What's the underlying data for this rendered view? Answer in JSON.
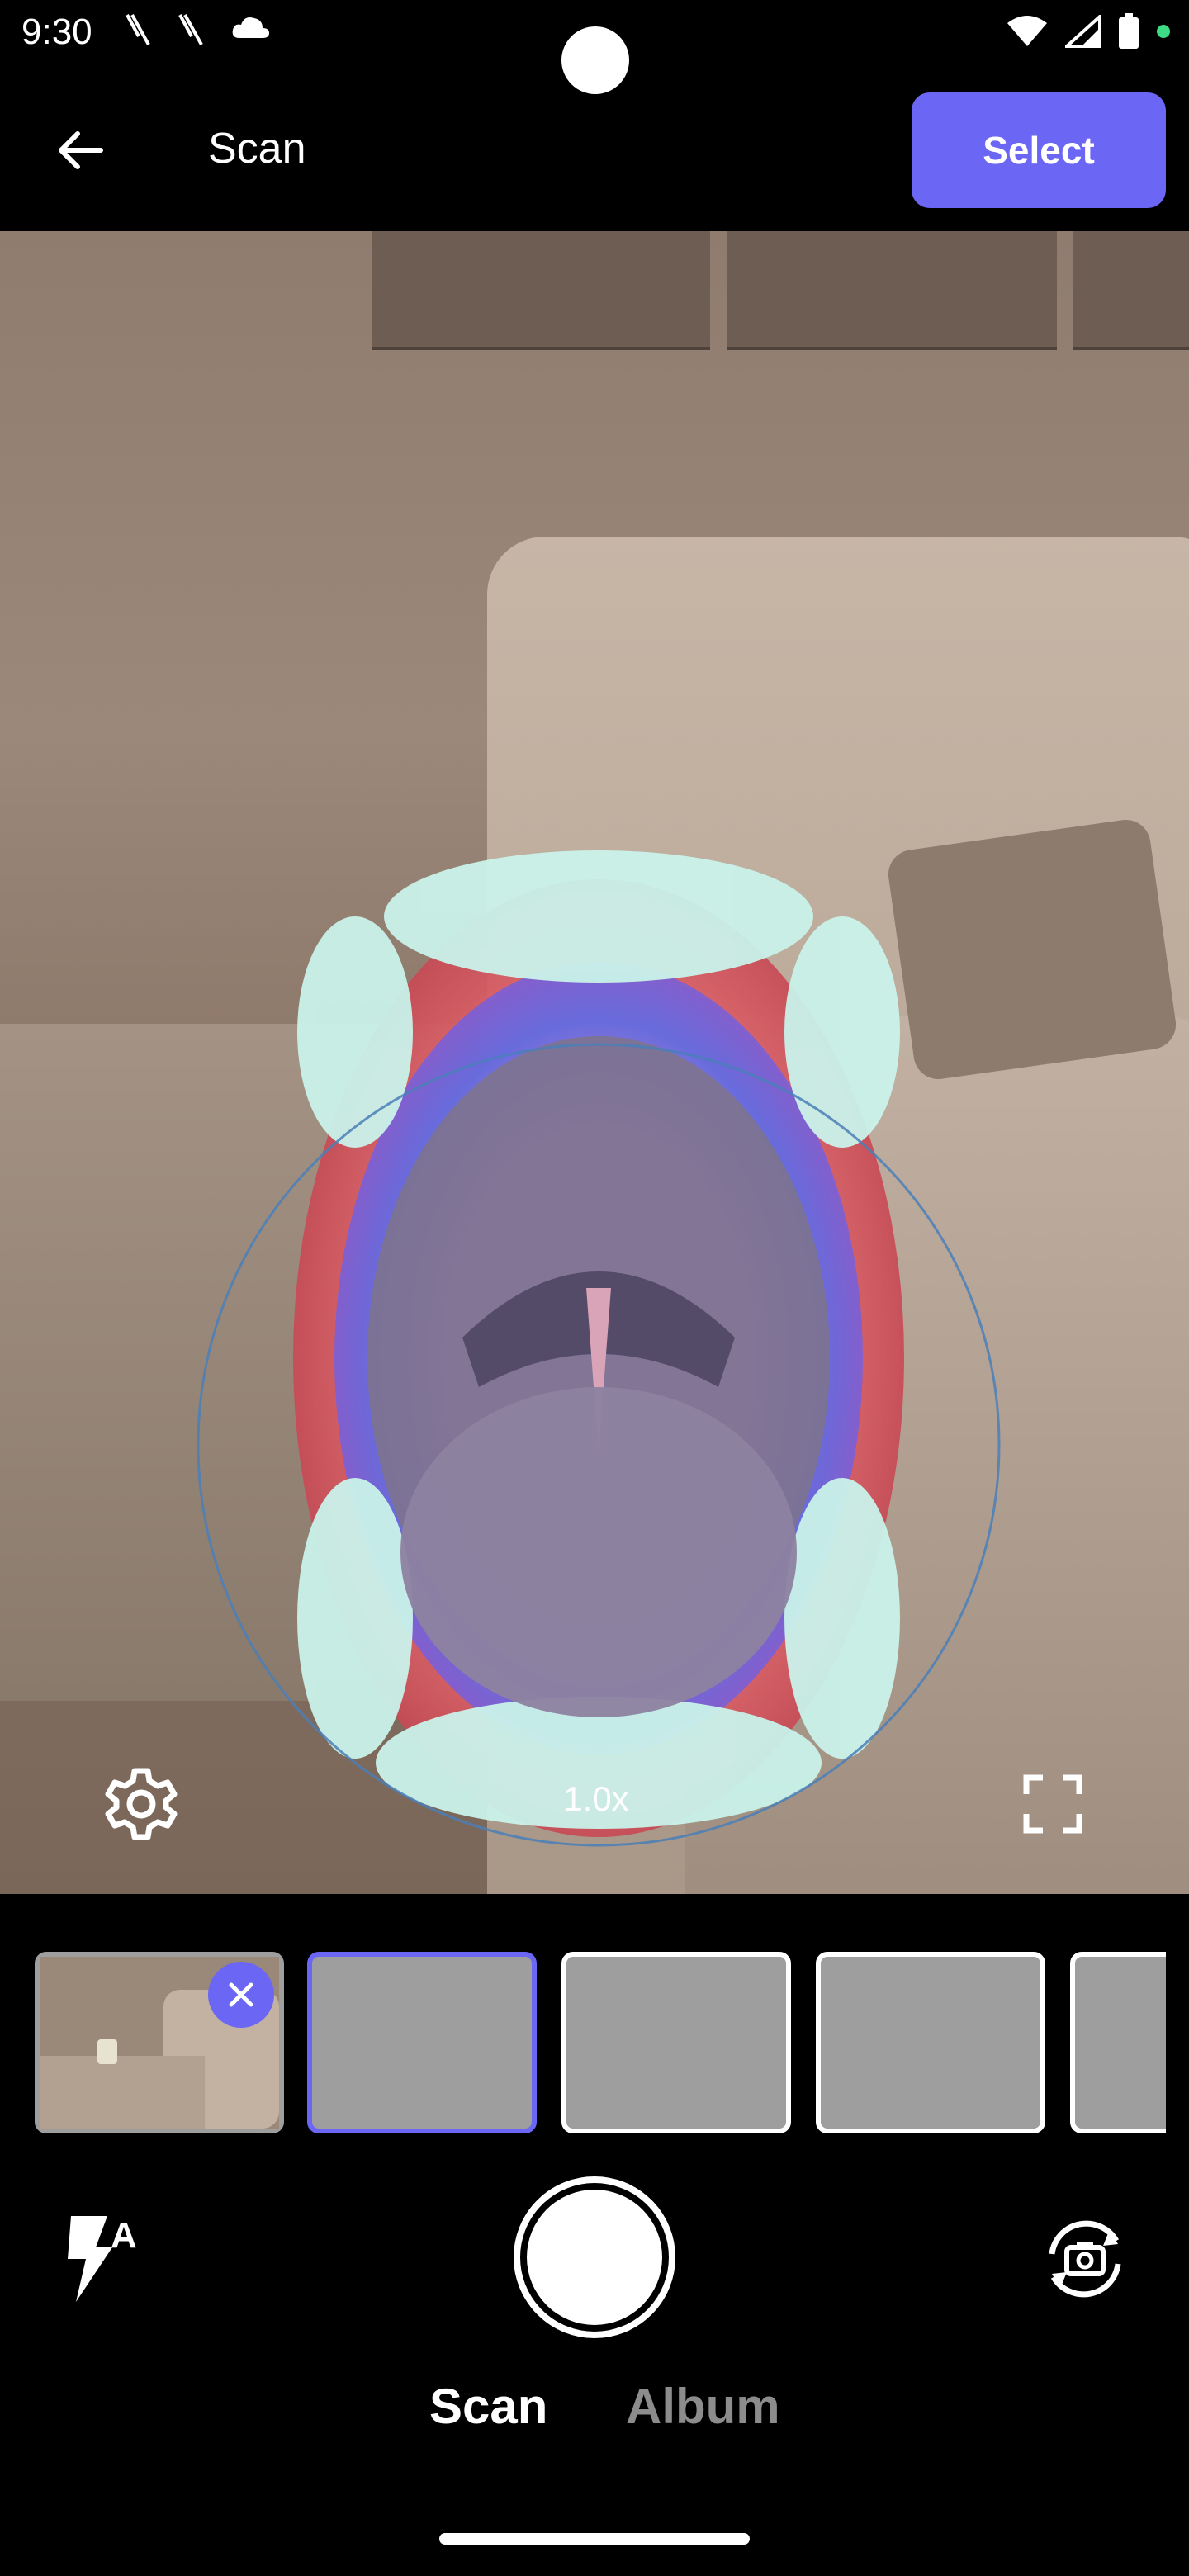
{
  "status_bar": {
    "time": "9:30",
    "icons_left": [
      "missed-call-icon",
      "missed-call-icon",
      "cloud-icon"
    ],
    "icons_right": [
      "wifi-icon",
      "signal-icon",
      "battery-icon",
      "privacy-dot-icon"
    ],
    "privacy_dot_color": "#3ddc84"
  },
  "app_bar": {
    "title": "Scan",
    "back_icon": "arrow-back-icon",
    "select_label": "Select",
    "accent": "#6b66f4"
  },
  "viewfinder": {
    "zoom": "1.0x",
    "settings_icon": "gear-icon",
    "fullscreen_icon": "fullscreen-icon",
    "overlay": "mouth-guide-overlay"
  },
  "thumbnails": [
    {
      "state": "captured",
      "remove_icon": "close-icon"
    },
    {
      "state": "active"
    },
    {
      "state": "empty"
    },
    {
      "state": "empty"
    },
    {
      "state": "empty"
    }
  ],
  "controls": {
    "flash_icon": "flash-auto-icon",
    "flash_text": "A",
    "shutter": "shutter-button",
    "flip_icon": "flip-camera-icon"
  },
  "mode_tabs": {
    "scan": "Scan",
    "album": "Album",
    "selected": "scan"
  }
}
